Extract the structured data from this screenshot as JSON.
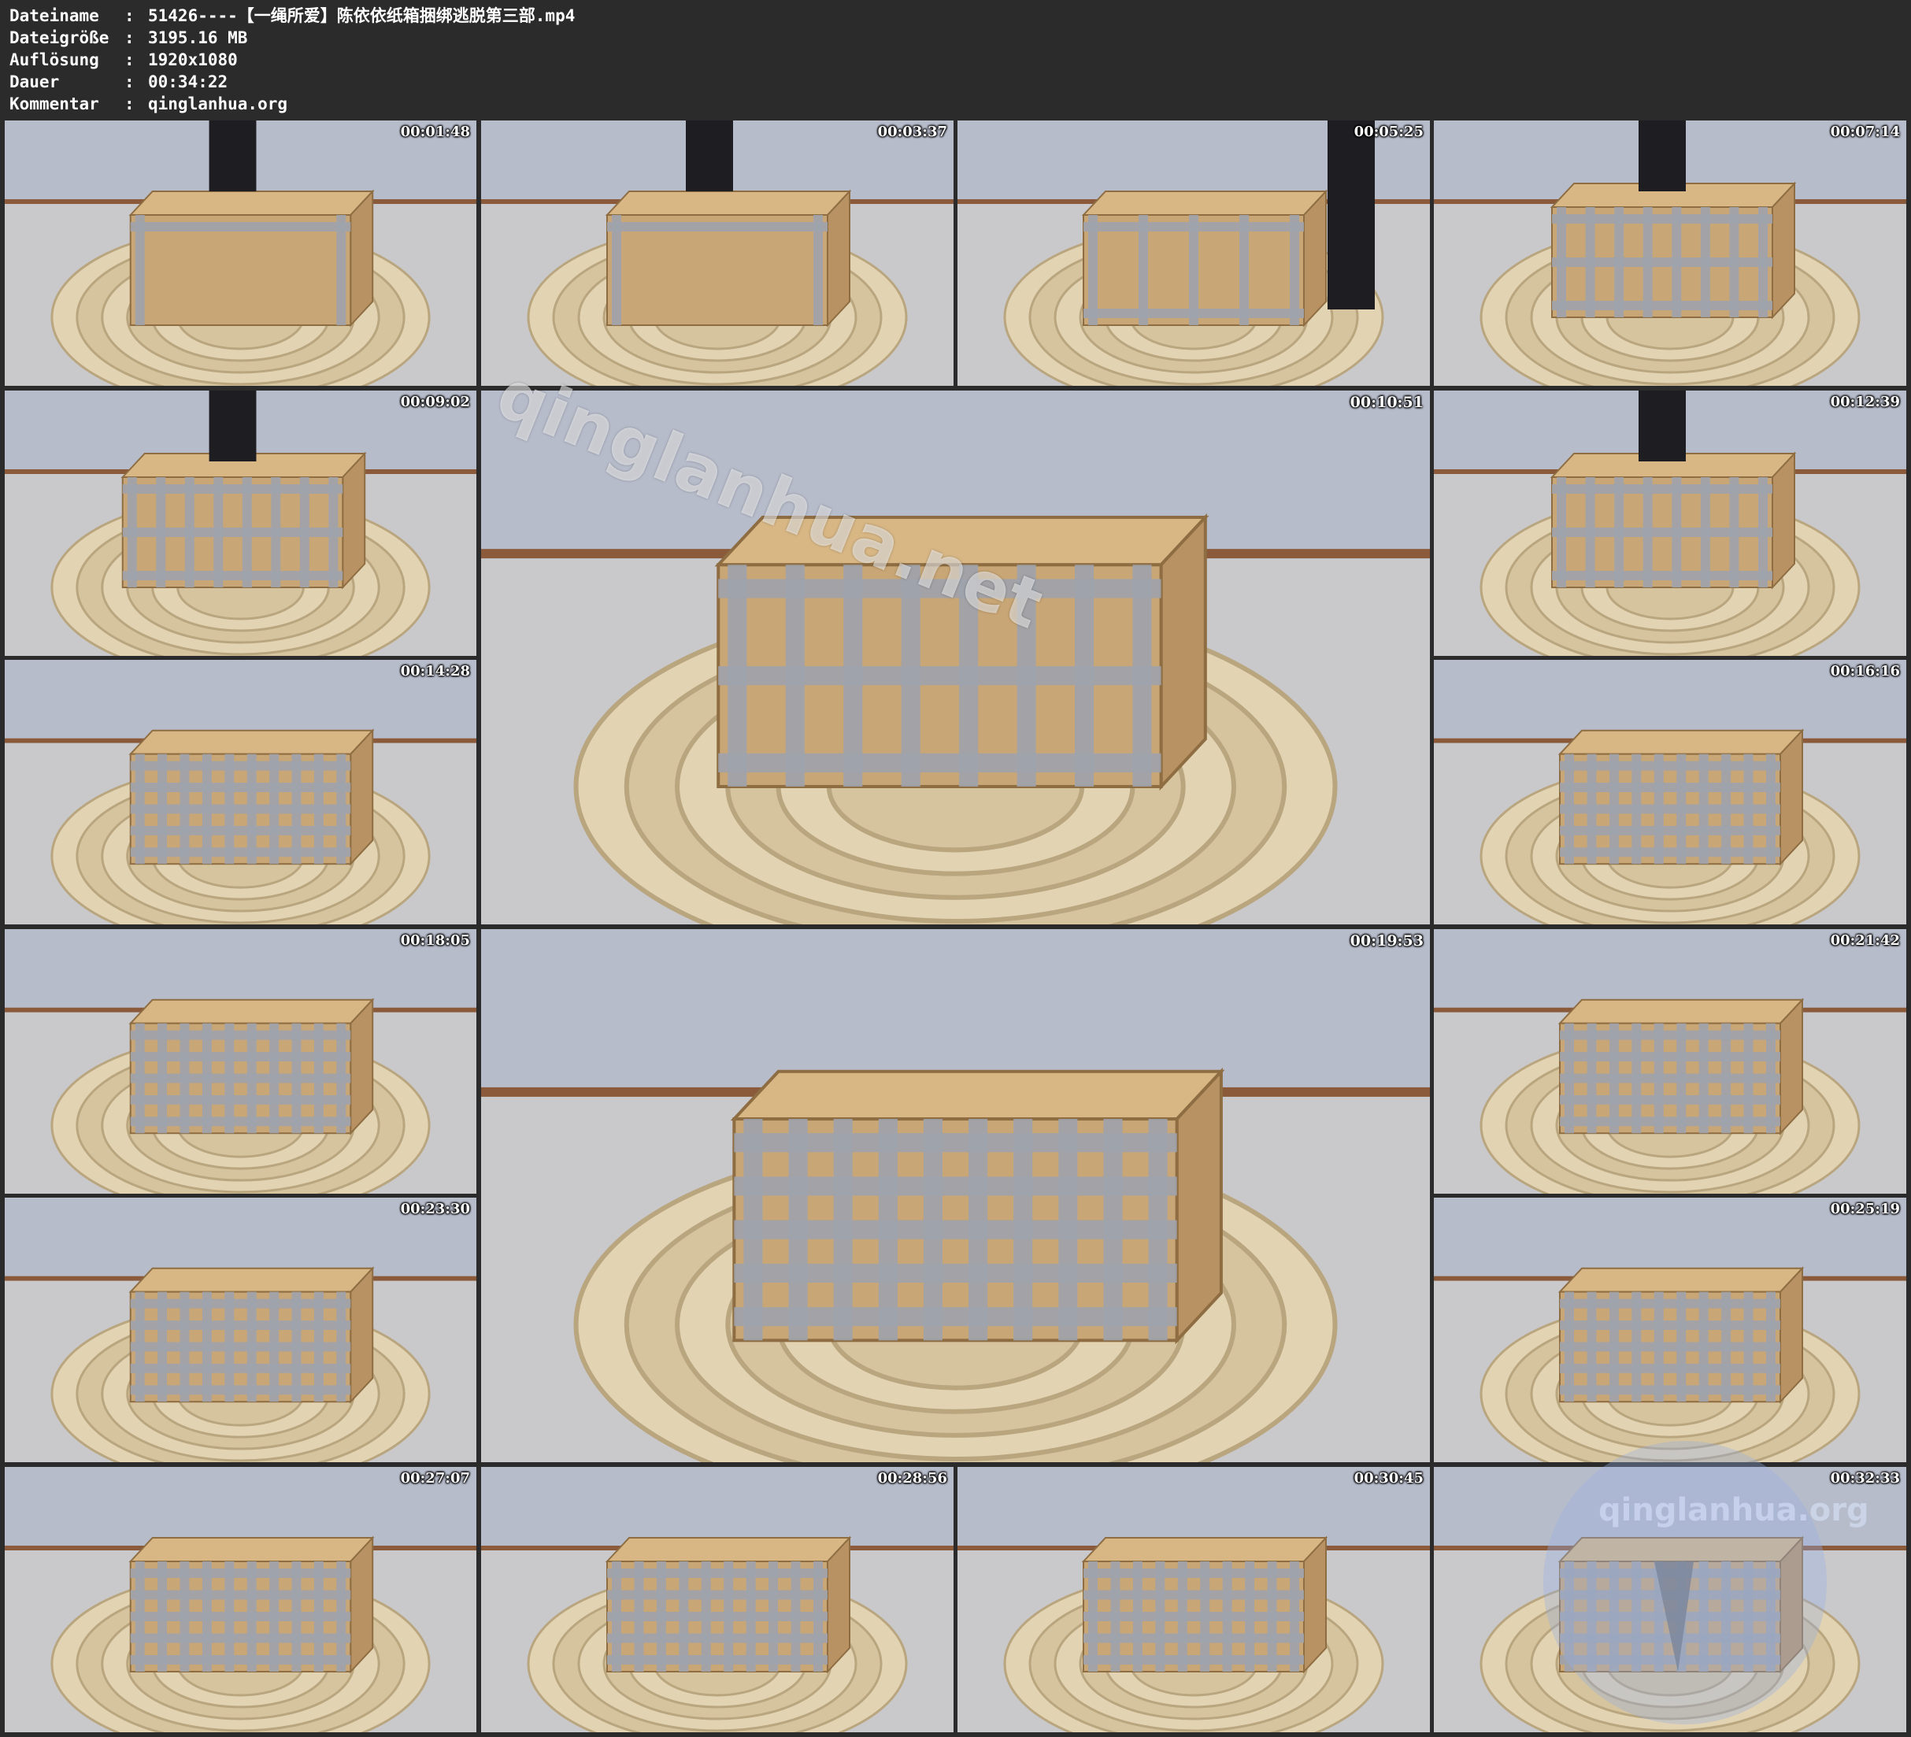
{
  "info": [
    {
      "key": "Dateiname",
      "value": "51426----【一绳所爱】陈依依纸箱捆绑逃脱第三部.mp4"
    },
    {
      "key": "Dateigröße",
      "value": "3195.16 MB"
    },
    {
      "key": "Auflösung",
      "value": "1920x1080"
    },
    {
      "key": "Dauer",
      "value": "00:34:22"
    },
    {
      "key": "Kommentar",
      "value": "qinglanhua.org"
    }
  ],
  "separator": ":",
  "thumbnails": [
    {
      "time": "00:01:48",
      "scene": "taping-start"
    },
    {
      "time": "00:03:37",
      "scene": "taping-start"
    },
    {
      "time": "00:05:25",
      "scene": "taping-side"
    },
    {
      "time": "00:07:14",
      "scene": "taped"
    },
    {
      "time": "00:09:02",
      "scene": "taped"
    },
    {
      "time": "00:10:51",
      "scene": "taped-big"
    },
    {
      "time": "00:12:39",
      "scene": "taped"
    },
    {
      "time": "00:14:28",
      "scene": "wrapped"
    },
    {
      "time": "00:16:16",
      "scene": "wrapped"
    },
    {
      "time": "00:18:05",
      "scene": "wrapped"
    },
    {
      "time": "00:19:53",
      "scene": "wrapped-big"
    },
    {
      "time": "00:21:42",
      "scene": "wrapped"
    },
    {
      "time": "00:23:30",
      "scene": "wrapped"
    },
    {
      "time": "00:25:19",
      "scene": "wrapped"
    },
    {
      "time": "00:27:07",
      "scene": "wrapped"
    },
    {
      "time": "00:28:56",
      "scene": "wrapped"
    },
    {
      "time": "00:30:45",
      "scene": "wrapped"
    },
    {
      "time": "00:32:33",
      "scene": "broken"
    }
  ],
  "watermarks": [
    "qinglanhua.net",
    "qinglanhua.org"
  ],
  "colors": {
    "background": "#2b2b2b",
    "wall": "#b7bccb",
    "floor": "#c9c9cc",
    "rug": "#e2d3b3",
    "cardboard": "#c9a675",
    "tape": "#9ea3ad"
  }
}
